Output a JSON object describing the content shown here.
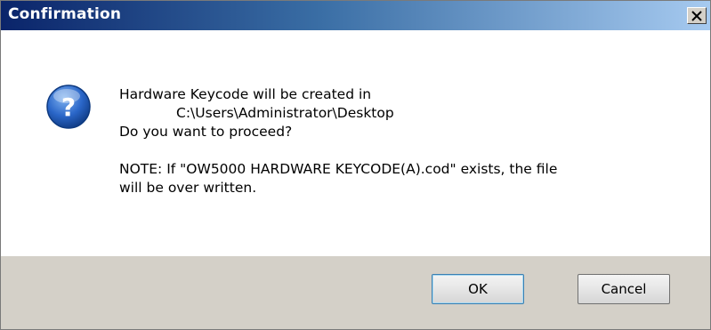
{
  "window": {
    "title": "Confirmation",
    "close_glyph": "✕"
  },
  "message": {
    "line1": "Hardware Keycode will be created in",
    "line2": "C:\\Users\\Administrator\\Desktop",
    "line3": "Do you want to proceed?",
    "note1": "NOTE: If \"OW5000 HARDWARE KEYCODE(A).cod\" exists, the file",
    "note2": "will be over written."
  },
  "buttons": {
    "ok_label": "OK",
    "cancel_label": "Cancel"
  },
  "icon": {
    "name": "question-icon",
    "glyph": "?",
    "color": "#1f5fbf"
  }
}
